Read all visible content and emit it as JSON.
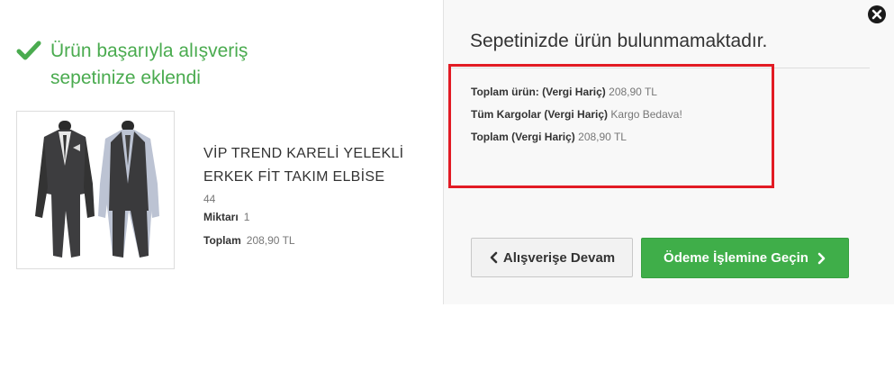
{
  "success": {
    "message_line1": "Ürün başarıyla alışveriş",
    "message_line2": "sepetinize eklendi"
  },
  "product": {
    "name_line1": "VİP TREND KARELİ YELEKLİ",
    "name_line2": "ERKEK FİT TAKIM ELBİSE",
    "size": "44",
    "quantity_label": "Miktarı",
    "quantity": "1",
    "total_label": "Toplam",
    "total": "208,90 TL"
  },
  "cart": {
    "title": "Sepetinizde ürün bulunmamaktadır.",
    "lines": [
      {
        "label": "Toplam ürün: (Vergi Hariç)",
        "value": "208,90 TL"
      },
      {
        "label": "Tüm Kargolar (Vergi Hariç)",
        "value": "Kargo Bedava!"
      },
      {
        "label": "Toplam (Vergi Hariç)",
        "value": "208,90 TL"
      }
    ]
  },
  "buttons": {
    "continue_label": "Alışverişe Devam",
    "checkout_label": "Ödeme İşlemine Geçin"
  },
  "colors": {
    "success_green": "#4aab4f",
    "highlight_red": "#e21b24",
    "checkout_green": "#3fae49"
  },
  "icons": [
    "check-icon",
    "close-icon",
    "chevron-left-icon",
    "chevron-right-icon"
  ]
}
